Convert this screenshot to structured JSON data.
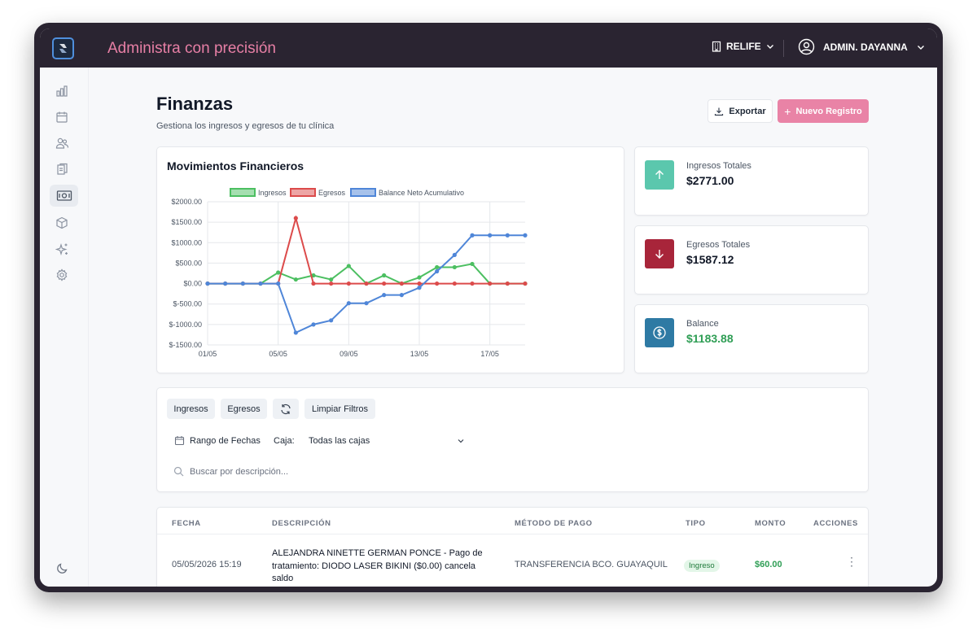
{
  "app": {
    "title": "Administra con precisión"
  },
  "header": {
    "clinic": "RELIFE",
    "user": "ADMIN. DAYANNA"
  },
  "sidebar": {
    "items": [
      {
        "name": "sidebar-item-dashboard",
        "icon": "bar-chart-icon"
      },
      {
        "name": "sidebar-item-calendar",
        "icon": "calendar-icon"
      },
      {
        "name": "sidebar-item-patients",
        "icon": "users-icon"
      },
      {
        "name": "sidebar-item-records",
        "icon": "clipboard-icon"
      },
      {
        "name": "sidebar-item-finances",
        "icon": "cash-icon",
        "active": true
      },
      {
        "name": "sidebar-item-inventory",
        "icon": "box-icon"
      },
      {
        "name": "sidebar-item-ai",
        "icon": "sparkles-icon"
      },
      {
        "name": "sidebar-item-settings",
        "icon": "gear-icon"
      }
    ],
    "theme_icon": "moon-icon"
  },
  "page": {
    "title": "Finanzas",
    "subtitle": "Gestiona los ingresos y egresos de tu clínica",
    "export_label": "Exportar",
    "new_label": "Nuevo Registro"
  },
  "stats": {
    "income": {
      "label": "Ingresos Totales",
      "value": "$2771.00",
      "color": "#5bc7ad"
    },
    "expense": {
      "label": "Egresos Totales",
      "value": "$1587.12",
      "color": "#a8253a"
    },
    "balance": {
      "label": "Balance",
      "value": "$1183.88",
      "color": "#2e7aa4",
      "value_color": "#2f9e55"
    }
  },
  "chart_data": {
    "type": "line",
    "title": "Movimientos Financieros",
    "x": [
      "01/05",
      "02/05",
      "03/05",
      "04/05",
      "05/05",
      "06/05",
      "07/05",
      "08/05",
      "09/05",
      "10/05",
      "11/05",
      "12/05",
      "13/05",
      "14/05",
      "15/05",
      "16/05",
      "17/05",
      "18/05",
      "19/05"
    ],
    "x_tick_labels": [
      "01/05",
      "05/05",
      "09/05",
      "13/05",
      "17/05"
    ],
    "y_tick_labels": [
      "$2000.00",
      "$1500.00",
      "$1000.00",
      "$500.00",
      "$0.00",
      "$-500.00",
      "$-1000.00",
      "$-1500.00"
    ],
    "ylim": [
      -1500,
      2000
    ],
    "legend_position": "top",
    "grid": true,
    "series": [
      {
        "name": "Ingresos",
        "color": "#4cbf61",
        "values": [
          0,
          0,
          0,
          0,
          270,
          100,
          200,
          100,
          430,
          0,
          200,
          0,
          150,
          400,
          400,
          480,
          0,
          0,
          0
        ]
      },
      {
        "name": "Egresos",
        "color": "#dc4b4b",
        "values": [
          0,
          0,
          0,
          0,
          0,
          1600,
          0,
          0,
          0,
          0,
          0,
          0,
          0,
          0,
          0,
          0,
          0,
          0,
          0
        ]
      },
      {
        "name": "Balance Neto Acumulativo",
        "color": "#4f86d8",
        "values": [
          0,
          0,
          0,
          0,
          0,
          -1200,
          -1000,
          -900,
          -480,
          -480,
          -280,
          -280,
          -100,
          300,
          700,
          1180,
          1180,
          1180,
          1180
        ]
      }
    ]
  },
  "filters": {
    "ingresos": "Ingresos",
    "egresos": "Egresos",
    "clear": "Limpiar Filtros",
    "date_range": "Rango de Fechas",
    "caja_label": "Caja:",
    "caja_value": "Todas las cajas",
    "search_placeholder": "Buscar por descripción..."
  },
  "table": {
    "headers": [
      "FECHA",
      "DESCRIPCIÓN",
      "MÉTODO DE PAGO",
      "TIPO",
      "MONTO",
      "ACCIONES"
    ],
    "rows": [
      {
        "fecha": "05/05/2026 15:19",
        "descripcion": "ALEJANDRA NINETTE GERMAN PONCE - Pago de tratamiento: DIODO LASER BIKINI ($0.00) cancela saldo",
        "metodo": "TRANSFERENCIA BCO. GUAYAQUIL",
        "tipo": "Ingreso",
        "monto": "$60.00"
      }
    ]
  }
}
